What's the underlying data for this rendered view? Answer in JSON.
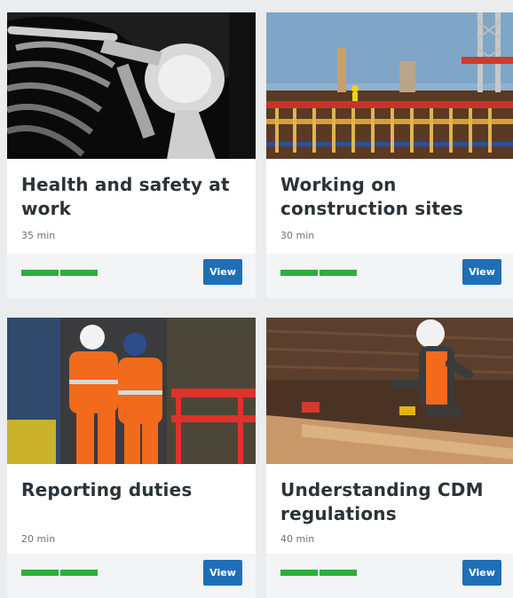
{
  "courses": [
    {
      "title": "Health and safety at work",
      "duration": "35 min",
      "progress": 1.0,
      "button_label": "View",
      "image": "x-ray-shoulder-image"
    },
    {
      "title": "Working on construction sites",
      "duration": "30 min",
      "progress": 1.0,
      "button_label": "View",
      "image": "construction-site-image"
    },
    {
      "title": "Reporting duties",
      "duration": "20 min",
      "progress": 1.0,
      "button_label": "View",
      "image": "workers-hi-vis-image"
    },
    {
      "title": "Understanding CDM regulations",
      "duration": "40 min",
      "progress": 1.0,
      "button_label": "View",
      "image": "carpenter-workshop-image"
    }
  ],
  "colors": {
    "progress_green": "#2eae3a",
    "button_blue": "#1f6fb8",
    "title_text": "#2b3338",
    "page_background": "#eaecee"
  }
}
